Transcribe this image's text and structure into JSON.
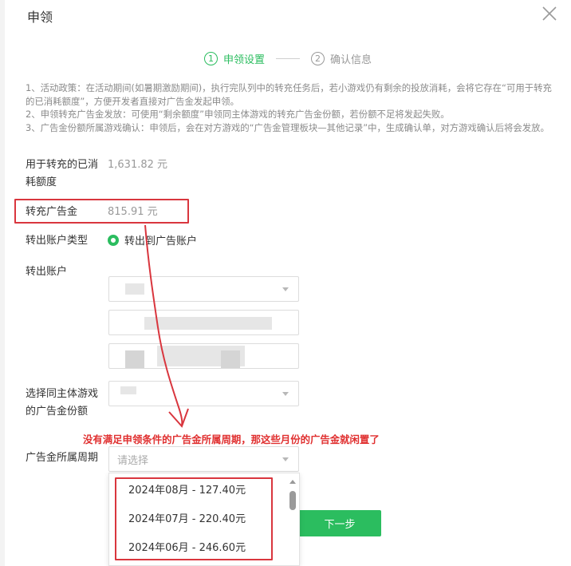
{
  "dialog": {
    "title": "申领",
    "close_icon": "close-icon"
  },
  "steps": [
    {
      "number": "1",
      "label": "申领设置",
      "active": true
    },
    {
      "number": "2",
      "label": "确认信息",
      "active": false
    }
  ],
  "notes": [
    "1、活动政策：在活动期间(如暑期激励期间)，执行完队列中的转充任务后，若小游戏仍有剩余的投放消耗，会将它存在“可用于转充的已消耗额度”，方便开发者直接对广告金发起申领。",
    "2、申领转充广告金发放：可使用“剩余额度”申领同主体游戏的转充广告金份额，若份额不足将发起失败。",
    "3、广告金份额所属游戏确认：申领后，会在对方游戏的“广告金管理板块—其他记录”中，生成确认单，对方游戏确认后将会发放。"
  ],
  "form": {
    "consumed_label": "用于转充的已消耗额度",
    "consumed_value": "1,631.82 元",
    "transfer_label": "转充广告金",
    "transfer_value": "815.91 元",
    "account_type_label": "转出账户类型",
    "account_type_option": "转出到广告账户",
    "account_label": "转出账户",
    "same_entity_label": "选择同主体游戏的广告金份额",
    "period_label": "广告金所属周期",
    "period_placeholder": "请选择"
  },
  "period_options": [
    "2024年08月 - 127.40元",
    "2024年07月 - 220.40元",
    "2024年06月 - 246.60元"
  ],
  "annotation": "没有满足申领条件的广告金所属周期，那这些月份的广告金就闲置了",
  "buttons": {
    "next": "下一步"
  },
  "colors": {
    "accent": "#2bbd5f",
    "annotation_red": "#d9363e"
  }
}
